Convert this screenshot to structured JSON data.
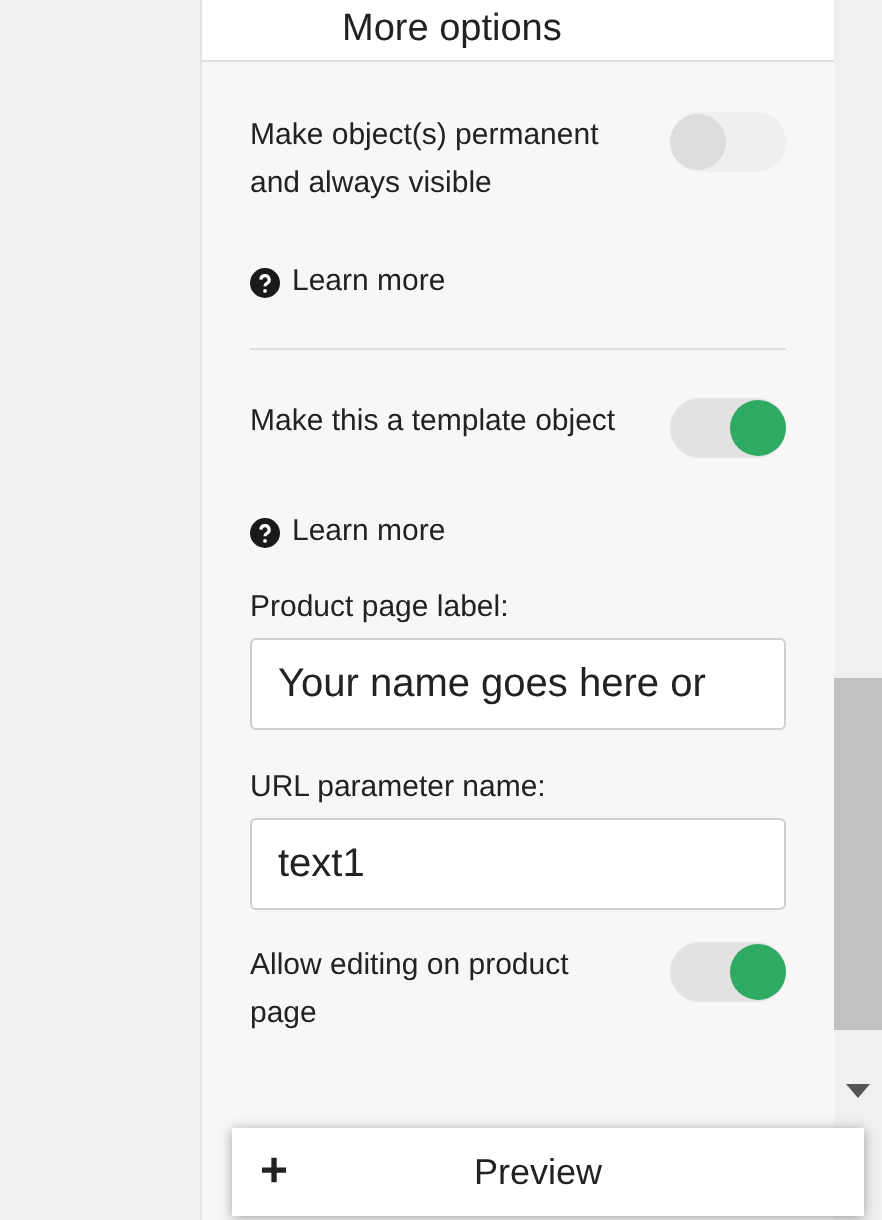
{
  "header": {
    "title": "More options"
  },
  "settings": [
    {
      "kind": "toggle",
      "label": "Make object(s) permanent and always visible",
      "on": false
    },
    {
      "kind": "link",
      "label": "Learn more"
    },
    {
      "kind": "divider"
    },
    {
      "kind": "toggle",
      "label": "Make this a template object",
      "on": true
    },
    {
      "kind": "link",
      "label": "Learn more"
    },
    {
      "kind": "field",
      "label": "Product page label:",
      "value": "Your name goes here or"
    },
    {
      "kind": "field",
      "label": "URL parameter name:",
      "value": "text1"
    },
    {
      "kind": "toggle",
      "label": "Allow editing on product page",
      "on": true
    }
  ],
  "preview_button": {
    "icon": "+",
    "label": "Preview"
  }
}
